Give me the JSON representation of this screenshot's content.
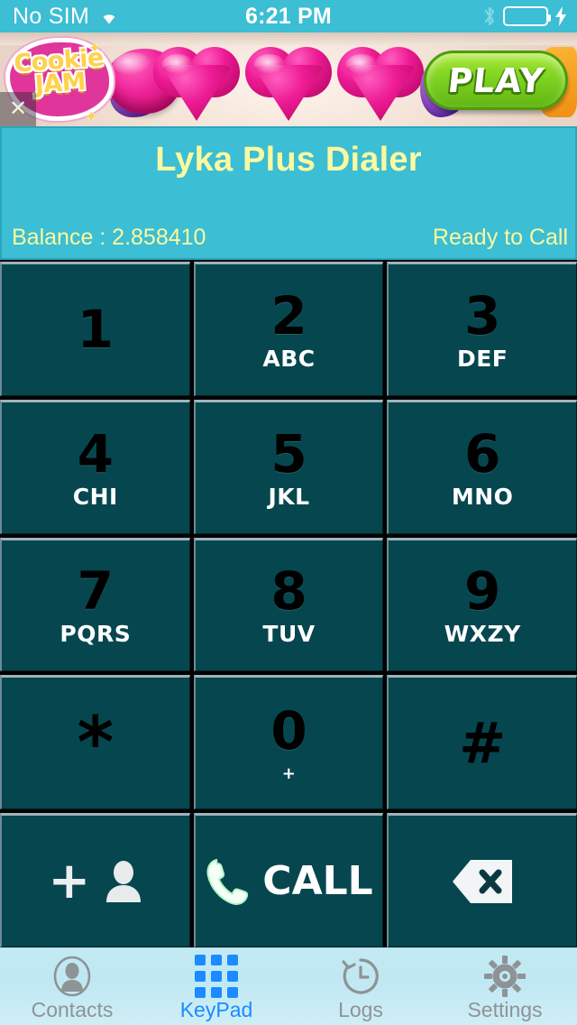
{
  "status_bar": {
    "carrier": "No SIM",
    "wifi_icon": "wifi-icon",
    "time": "6:21 PM",
    "bluetooth_icon": "bluetooth-icon",
    "battery_icon": "battery-full-icon",
    "charging_icon": "charging-bolt-icon",
    "background_color": "#3CBED4"
  },
  "ad_banner": {
    "brand": "Cookie Jam",
    "brand_line1": "Cookie",
    "brand_line2": "JAM",
    "cta_label": "PLAY",
    "close_label": "✕"
  },
  "header": {
    "title": "Lyka Plus Dialer",
    "balance": "Balance : 2.858410",
    "status": "Ready to Call",
    "background_color": "#3CBED4",
    "text_color": "#FBF9A0"
  },
  "keypad": {
    "keys": [
      {
        "digit": "1",
        "letters": ""
      },
      {
        "digit": "2",
        "letters": "ABC"
      },
      {
        "digit": "3",
        "letters": "DEF"
      },
      {
        "digit": "4",
        "letters": "CHI"
      },
      {
        "digit": "5",
        "letters": "JKL"
      },
      {
        "digit": "6",
        "letters": "MNO"
      },
      {
        "digit": "7",
        "letters": "PQRS"
      },
      {
        "digit": "8",
        "letters": "TUV"
      },
      {
        "digit": "9",
        "letters": "WXZY"
      },
      {
        "digit": "*",
        "letters": ""
      },
      {
        "digit": "0",
        "letters": "+"
      },
      {
        "digit": "#",
        "letters": ""
      }
    ],
    "actions": {
      "add_contact_icon": "add-contact-icon",
      "call_label": "CALL",
      "call_icon": "phone-icon",
      "backspace_icon": "backspace-icon"
    },
    "button_color": "#06464F"
  },
  "tab_bar": {
    "background_color": "#BFE8F2",
    "active_color": "#1B8BFF",
    "inactive_color": "#8E9396",
    "tabs": [
      {
        "label": "Contacts",
        "icon": "contacts-icon",
        "active": false
      },
      {
        "label": "KeyPad",
        "icon": "keypad-grid-icon",
        "active": true
      },
      {
        "label": "Logs",
        "icon": "history-clock-icon",
        "active": false
      },
      {
        "label": "Settings",
        "icon": "gear-icon",
        "active": false
      }
    ]
  }
}
